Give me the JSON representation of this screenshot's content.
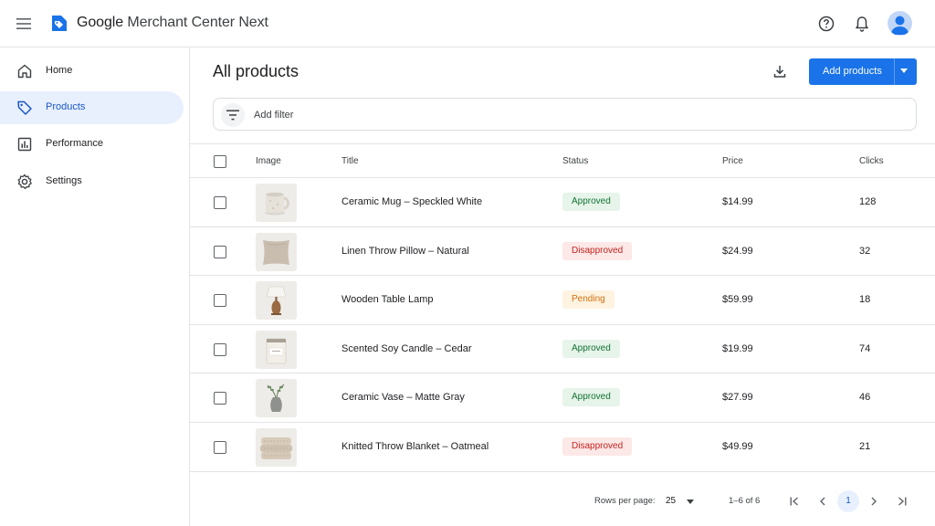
{
  "app": {
    "title_brand": "Google",
    "title_rest": " Merchant Center Next"
  },
  "sidebar": {
    "items": [
      {
        "label": "Home",
        "icon": "home-icon",
        "active": false
      },
      {
        "label": "Products",
        "icon": "tag-icon",
        "active": true
      },
      {
        "label": "Performance",
        "icon": "bar-chart-icon",
        "active": false
      },
      {
        "label": "Settings",
        "icon": "gear-icon",
        "active": false
      }
    ]
  },
  "main": {
    "title": "All products",
    "add_button": "Add products",
    "filter_label": "Add filter"
  },
  "table": {
    "columns": [
      "Image",
      "Title",
      "Status",
      "Price",
      "Clicks"
    ],
    "rows": [
      {
        "title": "Ceramic Mug – Speckled White",
        "status": "Approved",
        "status_kind": "approved",
        "price": "$14.99",
        "clicks": "128",
        "image": "mug"
      },
      {
        "title": "Linen Throw Pillow – Natural",
        "status": "Disapproved",
        "status_kind": "disapproved",
        "price": "$24.99",
        "clicks": "32",
        "image": "pillow"
      },
      {
        "title": "Wooden Table Lamp",
        "status": "Pending",
        "status_kind": "pending",
        "price": "$59.99",
        "clicks": "18",
        "image": "lamp"
      },
      {
        "title": "Scented Soy Candle – Cedar",
        "status": "Approved",
        "status_kind": "approved",
        "price": "$19.99",
        "clicks": "74",
        "image": "candle"
      },
      {
        "title": "Ceramic Vase – Matte Gray",
        "status": "Approved",
        "status_kind": "approved",
        "price": "$27.99",
        "clicks": "46",
        "image": "vase"
      },
      {
        "title": "Knitted Throw Blanket – Oatmeal",
        "status": "Disapproved",
        "status_kind": "disapproved",
        "price": "$49.99",
        "clicks": "21",
        "image": "blanket"
      }
    ]
  },
  "pagination": {
    "rows_per_page_label": "Rows per page:",
    "rows_per_page": "25",
    "range": "1–6 of 6",
    "current_page": "1"
  },
  "colors": {
    "accent": "#1a73e8",
    "active_nav_bg": "#e8f0fe",
    "approved": "#137333",
    "disapproved": "#c5221f",
    "pending": "#d56e0c"
  }
}
